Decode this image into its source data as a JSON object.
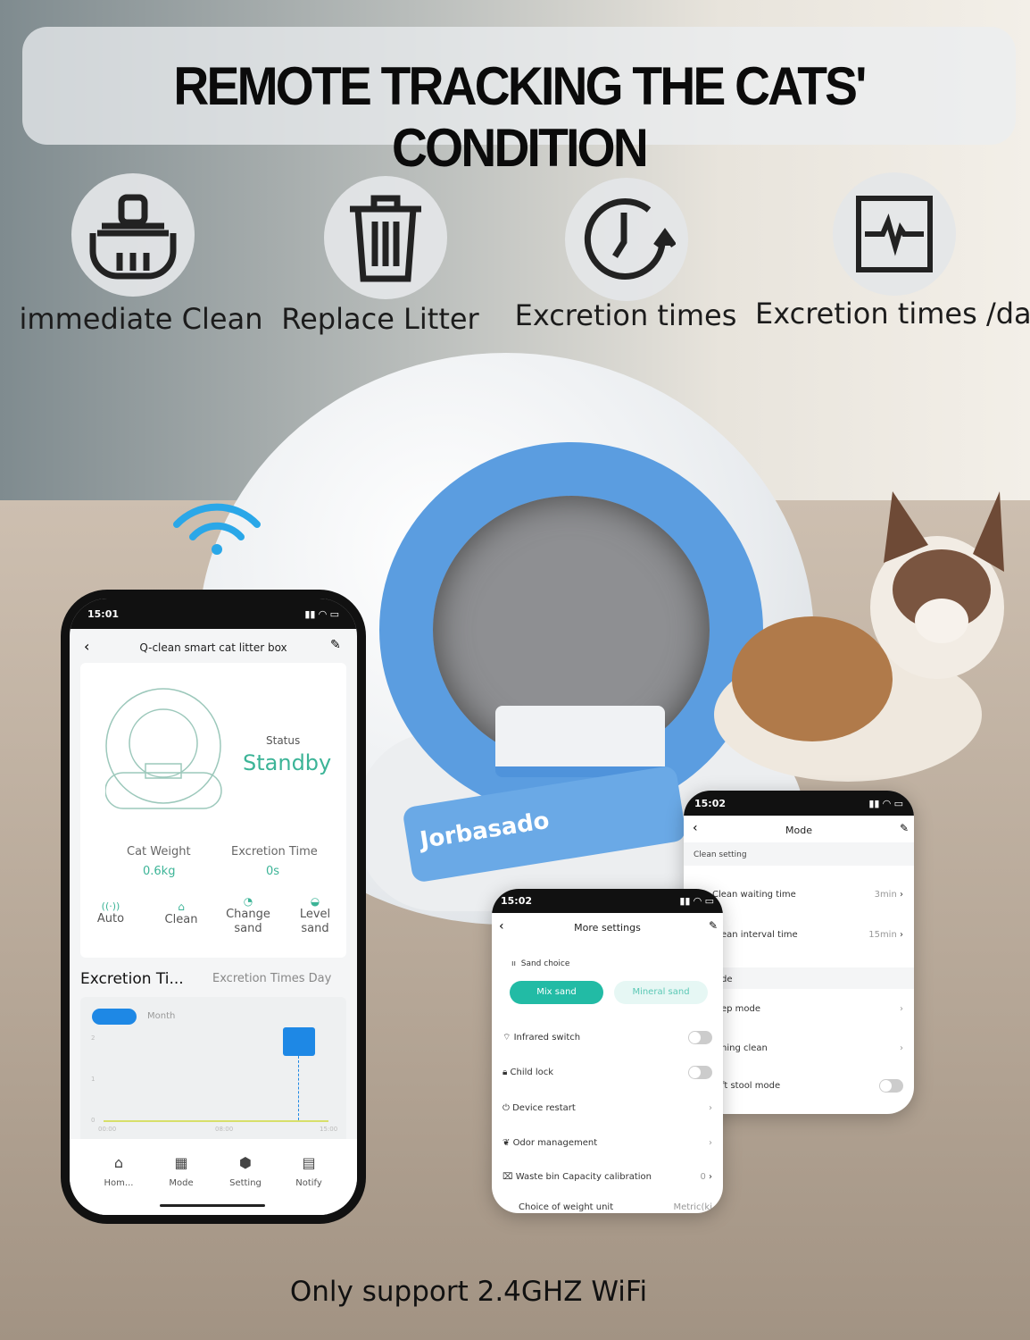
{
  "banner": {
    "title": "REMOTE TRACKING THE CATS'  CONDITION"
  },
  "features": [
    {
      "icon": "broom-basket-icon",
      "label": "immediate Clean"
    },
    {
      "icon": "trash-can-icon",
      "label": "Replace Litter"
    },
    {
      "icon": "clock-refresh-icon",
      "label": "Excretion times"
    },
    {
      "icon": "heartbeat-monitor-icon",
      "label": "Excretion times /day"
    }
  ],
  "product": {
    "brand": "Jorbasado"
  },
  "colors": {
    "accent": "#3cb497",
    "blue": "#5b9de0",
    "chart_bar": "#1e88e5"
  },
  "main_phone": {
    "time": "15:01",
    "title": "Q-clean smart cat litter box",
    "status_label": "Status",
    "status_value": "Standby",
    "cat_weight_label": "Cat Weight",
    "cat_weight_value": "0.6kg",
    "excretion_time_label": "Excretion Time",
    "excretion_time_value": "0s",
    "actions": [
      {
        "label": "Auto"
      },
      {
        "label": "Clean"
      },
      {
        "label": "Change sand"
      },
      {
        "label": "Level sand"
      }
    ],
    "chart_tab_active": "Excretion Ti...",
    "chart_tab_inactive": "Excretion Times Day",
    "period_toggle_inactive": "Month",
    "chart": {
      "y_ticks": [
        "2",
        "1",
        "0"
      ],
      "x_ticks": [
        "00:00",
        "08:00",
        "15:00"
      ]
    },
    "nav": [
      {
        "label": "Hom..."
      },
      {
        "label": "Mode"
      },
      {
        "label": "Setting"
      },
      {
        "label": "Notify"
      }
    ]
  },
  "mode_card": {
    "time": "15:02",
    "title": "Mode",
    "section": "Clean setting",
    "rows": [
      {
        "label": "Clean waiting time",
        "value": "3min"
      },
      {
        "label": "ean interval time",
        "value": "15min"
      },
      {
        "label": "de"
      },
      {
        "label": "ep mode"
      },
      {
        "label": "ning clean"
      },
      {
        "label": "ft stool mode",
        "toggle": false
      }
    ]
  },
  "settings_card": {
    "time": "15:02",
    "title": "More settings",
    "sand_label": "Sand choice",
    "sand_options": [
      {
        "label": "Mix sand",
        "selected": true
      },
      {
        "label": "Mineral sand",
        "selected": false
      }
    ],
    "rows": [
      {
        "label": "Infrared switch",
        "toggle": false
      },
      {
        "label": "Child lock",
        "toggle": false
      },
      {
        "label": "Device restart"
      },
      {
        "label": "Odor management"
      },
      {
        "label": "Waste bin Capacity calibration",
        "value": "0"
      },
      {
        "label": "Choice of weight unit",
        "value": "Metric(ki"
      }
    ]
  },
  "footer": {
    "text": "Only support 2.4GHZ WiFi"
  }
}
